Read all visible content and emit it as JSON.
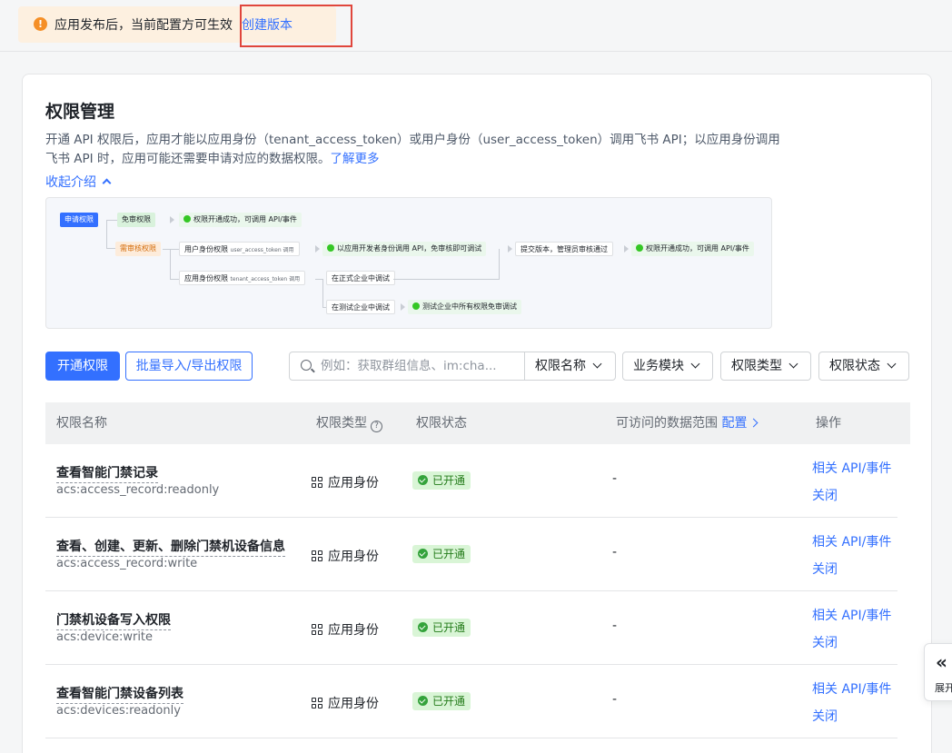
{
  "notice": {
    "text": "应用发布后，当前配置方可生效",
    "link": "创建版本"
  },
  "card": {
    "title": "权限管理",
    "description": "开通 API 权限后，应用才能以应用身份（tenant_access_token）或用户身份（user_access_token）调用飞书 API；以应用身份调用飞书 API 时，应用可能还需要申请对应的数据权限。",
    "learn_more": "了解更多",
    "collapse": "收起介绍"
  },
  "diagram": {
    "apply": "申请权限",
    "no_review": "免审权限",
    "enabled_ok": "权限开通成功，可调用 API/事件",
    "need_review": "需审核权限",
    "user_perm": "用户身份权限",
    "user_token": "user_access_token 调用",
    "dev_call": "以应用开发者身份调用 API，免审核即可调试",
    "submit": "提交版本，管理员审核通过",
    "enabled_ok2": "权限开通成功，可调用 API/事件",
    "app_perm": "应用身份权限",
    "tenant_token": "tenant_access_token 调用",
    "prod_debug": "在正式企业中调试",
    "test_debug": "在测试企业中调试",
    "test_all": "测试企业中所有权限免审调试"
  },
  "toolbar": {
    "enable": "开通权限",
    "batch": "批量导入/导出权限",
    "search_placeholder": "例如：获取群组信息、im:cha...",
    "search_field": "权限名称",
    "filters": [
      "业务模块",
      "权限类型",
      "权限状态"
    ]
  },
  "table": {
    "headers": {
      "name": "权限名称",
      "type": "权限类型",
      "status": "权限状态",
      "scope": "可访问的数据范围",
      "scope_link": "配置",
      "action": "操作"
    },
    "rows": [
      {
        "name": "查看智能门禁记录",
        "code": "acs:access_record:readonly",
        "type": "应用身份",
        "status": "已开通",
        "scope": "-",
        "action1": "相关 API/事件",
        "action2": "关闭"
      },
      {
        "name": "查看、创建、更新、删除门禁机设备信息",
        "code": "acs:access_record:write",
        "type": "应用身份",
        "status": "已开通",
        "scope": "-",
        "action1": "相关 API/事件",
        "action2": "关闭"
      },
      {
        "name": "门禁机设备写入权限",
        "code": "acs:device:write",
        "type": "应用身份",
        "status": "已开通",
        "scope": "-",
        "action1": "相关 API/事件",
        "action2": "关闭"
      },
      {
        "name": "查看智能门禁设备列表",
        "code": "acs:devices:readonly",
        "type": "应用身份",
        "status": "已开通",
        "scope": "-",
        "action1": "相关 API/事件",
        "action2": "关闭"
      }
    ]
  },
  "side_tab": {
    "icon": "«",
    "label": "展开"
  },
  "colors": {
    "accent": "#3370ff",
    "notice_bg": "#fdf0e0",
    "warning": "#f58f27",
    "success": "#34a33b",
    "highlight": "#e0463c"
  }
}
